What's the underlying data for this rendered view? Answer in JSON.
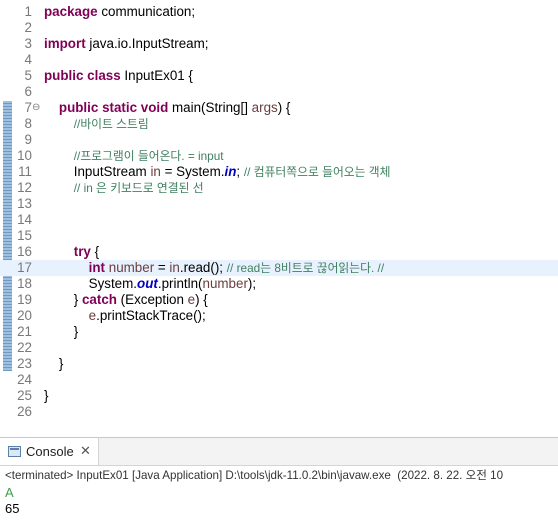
{
  "editor": {
    "lines": [
      {
        "n": "1",
        "tokens": [
          {
            "t": "package",
            "c": "kw"
          },
          {
            "t": " communication;"
          }
        ]
      },
      {
        "n": "2",
        "tokens": []
      },
      {
        "n": "3",
        "tokens": [
          {
            "t": "import",
            "c": "kw"
          },
          {
            "t": " java.io.InputStream;"
          }
        ]
      },
      {
        "n": "4",
        "tokens": []
      },
      {
        "n": "5",
        "tokens": [
          {
            "t": "public",
            "c": "kw"
          },
          {
            "t": " "
          },
          {
            "t": "class",
            "c": "kw"
          },
          {
            "t": " InputEx01 {"
          }
        ]
      },
      {
        "n": "6",
        "tokens": []
      },
      {
        "n": "7",
        "fold": "⊖",
        "tokens": [
          {
            "t": "    "
          },
          {
            "t": "public",
            "c": "kw"
          },
          {
            "t": " "
          },
          {
            "t": "static",
            "c": "kw"
          },
          {
            "t": " "
          },
          {
            "t": "void",
            "c": "kw"
          },
          {
            "t": " main(String[] "
          },
          {
            "t": "args",
            "c": "var"
          },
          {
            "t": ") {"
          }
        ]
      },
      {
        "n": "8",
        "tokens": [
          {
            "t": "        "
          },
          {
            "t": "//바이트 스트림",
            "c": "cm"
          }
        ]
      },
      {
        "n": "9",
        "tokens": []
      },
      {
        "n": "10",
        "tokens": [
          {
            "t": "        "
          },
          {
            "t": "//프로그램이 들어온다. = input",
            "c": "cm"
          }
        ]
      },
      {
        "n": "11",
        "tokens": [
          {
            "t": "        InputStream "
          },
          {
            "t": "in",
            "c": "var"
          },
          {
            "t": " = System."
          },
          {
            "t": "in",
            "c": "fld"
          },
          {
            "t": "; "
          },
          {
            "t": "// 컴퓨터쪽으로 들어오는 객체",
            "c": "cm"
          }
        ]
      },
      {
        "n": "12",
        "tokens": [
          {
            "t": "        "
          },
          {
            "t": "// in 은 키보드로 연결된 선",
            "c": "cm"
          }
        ]
      },
      {
        "n": "13",
        "tokens": []
      },
      {
        "n": "14",
        "tokens": []
      },
      {
        "n": "15",
        "tokens": []
      },
      {
        "n": "16",
        "tokens": [
          {
            "t": "        "
          },
          {
            "t": "try",
            "c": "kw"
          },
          {
            "t": " {"
          }
        ]
      },
      {
        "n": "17",
        "current": true,
        "tokens": [
          {
            "t": "            "
          },
          {
            "t": "int",
            "c": "kw"
          },
          {
            "t": " "
          },
          {
            "t": "number",
            "c": "var"
          },
          {
            "t": " = "
          },
          {
            "t": "in",
            "c": "var"
          },
          {
            "t": ".read(); "
          },
          {
            "t": "// read는 8비트로 끊어읽는다. //",
            "c": "cm"
          }
        ]
      },
      {
        "n": "18",
        "tokens": [
          {
            "t": "            System."
          },
          {
            "t": "out",
            "c": "fld"
          },
          {
            "t": ".println("
          },
          {
            "t": "number",
            "c": "var"
          },
          {
            "t": ");"
          }
        ]
      },
      {
        "n": "19",
        "tokens": [
          {
            "t": "        } "
          },
          {
            "t": "catch",
            "c": "kw"
          },
          {
            "t": " (Exception "
          },
          {
            "t": "e",
            "c": "var"
          },
          {
            "t": ") {"
          }
        ]
      },
      {
        "n": "20",
        "tokens": [
          {
            "t": "            "
          },
          {
            "t": "e",
            "c": "var"
          },
          {
            "t": ".printStackTrace();"
          }
        ]
      },
      {
        "n": "21",
        "tokens": [
          {
            "t": "        }"
          }
        ]
      },
      {
        "n": "22",
        "tokens": []
      },
      {
        "n": "23",
        "tokens": [
          {
            "t": "    }"
          }
        ]
      },
      {
        "n": "24",
        "tokens": []
      },
      {
        "n": "25",
        "tokens": [
          {
            "t": "}"
          }
        ]
      },
      {
        "n": "26",
        "tokens": []
      }
    ],
    "scroll_left_glyph": "<"
  },
  "console": {
    "tab_label": "Console",
    "close_glyph": "✕",
    "status": "<terminated> InputEx01 [Java Application] D:\\tools\\jdk-11.0.2\\bin\\javaw.exe  (2022. 8. 22. 오전 10",
    "output": [
      "A",
      "65"
    ]
  },
  "colors": {
    "keyword": "#7f0055",
    "comment": "#3f7f5f",
    "static_field": "#0000c0",
    "local_var": "#6a3e3e",
    "current_line": "#e8f2fe",
    "console_input": "#3ca04c"
  }
}
